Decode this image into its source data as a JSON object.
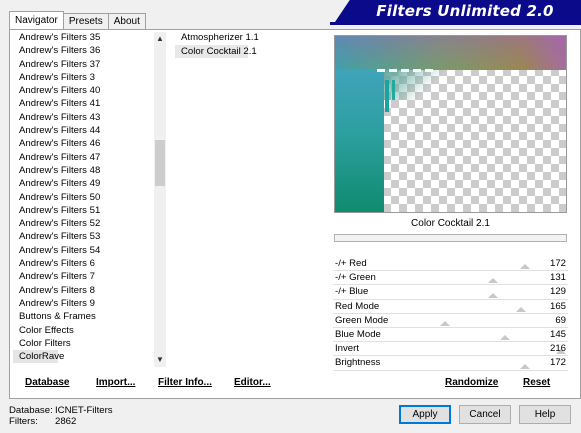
{
  "banner": {
    "title": "Filters Unlimited 2.0"
  },
  "tabs": [
    {
      "label": "Navigator",
      "active": true
    },
    {
      "label": "Presets",
      "active": false
    },
    {
      "label": "About",
      "active": false
    }
  ],
  "categories": {
    "items": [
      "Andrew's Filters 35",
      "Andrew's Filters 36",
      "Andrew's Filters 37",
      "Andrew's Filters 3",
      "Andrew's Filters 40",
      "Andrew's Filters 41",
      "Andrew's Filters 43",
      "Andrew's Filters 44",
      "Andrew's Filters 46",
      "Andrew's Filters 47",
      "Andrew's Filters 48",
      "Andrew's Filters 49",
      "Andrew's Filters 50",
      "Andrew's Filters 51",
      "Andrew's Filters 52",
      "Andrew's Filters 53",
      "Andrew's Filters 54",
      "Andrew's Filters 6",
      "Andrew's Filters 7",
      "Andrew's Filters 8",
      "Andrew's Filters 9",
      "Buttons & Frames",
      "Color Effects",
      "Color Filters",
      "ColorRave"
    ],
    "selected": "ColorRave",
    "scroll_up_icon": "▲",
    "scroll_down_icon": "▼"
  },
  "filters": {
    "items": [
      "Atmospherizer 1.1",
      "Color Cocktail 2.1"
    ],
    "selected": "Color Cocktail 2.1"
  },
  "preview": {
    "caption": "Color Cocktail 2.1"
  },
  "sliders": [
    {
      "label": "-/+ Red",
      "value": "172",
      "level": 0.67
    },
    {
      "label": "-/+ Green",
      "value": "131",
      "level": 0.51
    },
    {
      "label": "-/+ Blue",
      "value": "129",
      "level": 0.51
    },
    {
      "label": "Red Mode",
      "value": "165",
      "level": 0.65
    },
    {
      "label": "Green Mode",
      "value": "69",
      "level": 0.27
    },
    {
      "label": "Blue Mode",
      "value": "145",
      "level": 0.57
    },
    {
      "label": "Invert",
      "value": "216",
      "level": 0.85
    },
    {
      "label": "Brightness",
      "value": "172",
      "level": 0.67
    }
  ],
  "toolbar": {
    "database": "Database",
    "import": "Import...",
    "filter_info": "Filter Info...",
    "editor": "Editor...",
    "randomize": "Randomize",
    "reset": "Reset"
  },
  "footer": {
    "database_label": "Database:",
    "database_value": "ICNET-Filters",
    "filters_label": "Filters:",
    "filters_value": "2862",
    "apply": "Apply",
    "cancel": "Cancel",
    "help": "Help"
  }
}
